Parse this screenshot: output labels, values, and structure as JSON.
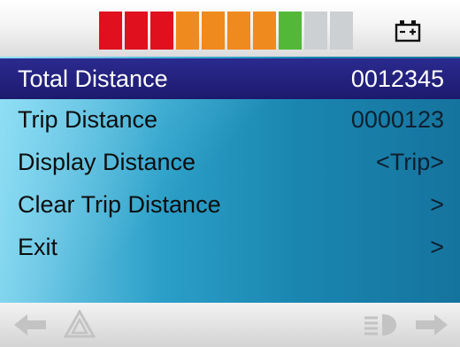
{
  "status": {
    "battery_segments": [
      "#e0101e",
      "#e0101e",
      "#e0101e",
      "#ef8a1e",
      "#ef8a1e",
      "#ef8a1e",
      "#ef8a1e",
      "#53b838",
      "#cdd0d2",
      "#cdd0d2"
    ],
    "battery_icon": "battery-icon"
  },
  "menu": {
    "items": [
      {
        "label": "Total Distance",
        "value": "0012345"
      },
      {
        "label": "Trip Distance",
        "value": "0000123"
      },
      {
        "label": "Display Distance",
        "value": "<Trip>"
      },
      {
        "label": "Clear Trip Distance",
        "value": ">"
      },
      {
        "label": "Exit",
        "value": ">"
      }
    ]
  },
  "bottom": {
    "icons": [
      "arrow-left-icon",
      "hazard-warning-icon",
      "headlight-icon",
      "arrow-right-icon"
    ]
  },
  "colors": {
    "selected_bg": "#2b2a8f",
    "screen_bg": "#1c89b4"
  }
}
